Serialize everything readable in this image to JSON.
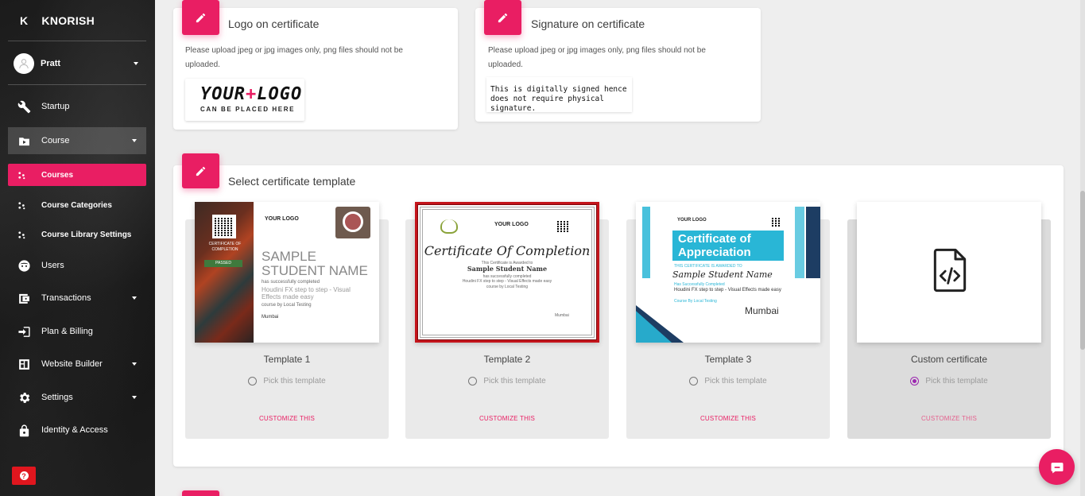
{
  "brand": {
    "initial": "K",
    "name": "KNORISH"
  },
  "user": {
    "name": "Pratt"
  },
  "nav": {
    "startup": "Startup",
    "course": "Course",
    "courses": "Courses",
    "course_categories": "Course Categories",
    "course_library_settings": "Course Library Settings",
    "users": "Users",
    "transactions": "Transactions",
    "plan_billing": "Plan & Billing",
    "website_builder": "Website Builder",
    "settings": "Settings",
    "identity_access": "Identity & Access"
  },
  "help": {
    "label": "?"
  },
  "logo_card": {
    "title": "Logo on certificate",
    "note": "Please upload jpeg or jpg images only, png files should not be uploaded.",
    "logo_text_a": "YOUR",
    "logo_text_plus": "+",
    "logo_text_b": "LOGO",
    "logo_sub": "CAN BE PLACED HERE"
  },
  "signature_card": {
    "title": "Signature on certificate",
    "note": "Please upload jpeg or jpg images only, png files should not be uploaded.",
    "line1": "This is digitally signed hence",
    "line2": "does not require physical signature."
  },
  "templates_card": {
    "title": "Select certificate template",
    "pick_label": "Pick this template",
    "customize_label": "CUSTOMIZE THIS",
    "templates": [
      {
        "name": "Template 1",
        "selected": false
      },
      {
        "name": "Template 2",
        "selected": false
      },
      {
        "name": "Template 3",
        "selected": false
      },
      {
        "name": "Custom certificate",
        "selected": true
      }
    ],
    "previews": {
      "t1": {
        "cert_of": "CERTIFICATE OF COMPLETION",
        "passed": "PASSED",
        "name_line1": "SAMPLE",
        "name_line2": "STUDENT NAME",
        "completed": "has successfully completed",
        "course": "Houdini FX step to step - Visual Effects made easy",
        "by": "course by Local Testing",
        "city": "Mumbai",
        "logo": "YOUR LOGO"
      },
      "t2": {
        "title": "Certificate Of Completion",
        "awarded": "This Certificate is Awarded to",
        "student": "Sample Student Name",
        "completed": "has successfully completed",
        "course": "Houdini FX step to step - Visual Effects made easy",
        "by": "course by Local Testing",
        "city": "Mumbai",
        "logo": "YOUR LOGO"
      },
      "t3": {
        "title1": "Certificate of",
        "title2": "Appreciation",
        "awarded": "THIS CERTIFICATE IS AWARDED TO",
        "student": "Sample Student Name",
        "completed": "Has Successfully Completed",
        "course": "Houdini FX step to step - Visual Effects made easy",
        "by": "Course By Local Testing",
        "city": "Mumbai",
        "logo": "YOUR LOGO"
      }
    }
  },
  "colors": {
    "accent": "#e91e63",
    "sidebar": "#1b1b1b",
    "radio_selected": "#9c27b0",
    "template2_border": "#c4151c"
  }
}
